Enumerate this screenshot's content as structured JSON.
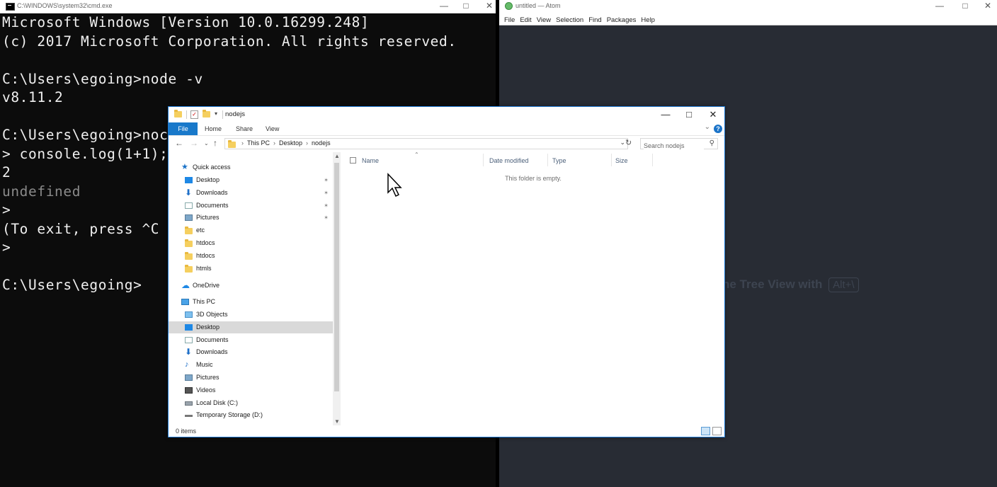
{
  "cmd": {
    "title": "C:\\WINDOWS\\system32\\cmd.exe",
    "lines": [
      {
        "text": "Microsoft Windows [Version 10.0.16299.248]",
        "style": "white"
      },
      {
        "text": "(c) 2017 Microsoft Corporation. All rights reserved.",
        "style": "white"
      },
      {
        "text": "",
        "style": ""
      },
      {
        "text": "C:\\Users\\egoing>node -v",
        "style": "white"
      },
      {
        "text": "v8.11.2",
        "style": "white"
      },
      {
        "text": "",
        "style": ""
      },
      {
        "text": "C:\\Users\\egoing>noc",
        "style": "white"
      },
      {
        "text": "> console.log(1+1);",
        "style": "white"
      },
      {
        "text": "2",
        "style": "white"
      },
      {
        "text": "undefined",
        "style": "dim"
      },
      {
        "text": ">",
        "style": "white"
      },
      {
        "text": "(To exit, press ^C",
        "style": "white"
      },
      {
        "text": ">",
        "style": "white"
      },
      {
        "text": "",
        "style": ""
      },
      {
        "text": "C:\\Users\\egoing>",
        "style": "white"
      }
    ]
  },
  "atom": {
    "title": "untitled — Atom",
    "menu": [
      "File",
      "Edit",
      "View",
      "Selection",
      "Find",
      "Packages",
      "Help"
    ],
    "hint_text": "he Tree View with",
    "hint_key": "Alt+\\"
  },
  "explorer": {
    "title": "nodejs",
    "ribbon_tabs": [
      "File",
      "Home",
      "Share",
      "View"
    ],
    "breadcrumb": [
      "This PC",
      "Desktop",
      "nodejs"
    ],
    "search_placeholder": "Search nodejs",
    "columns": [
      "Name",
      "Date modified",
      "Type",
      "Size"
    ],
    "empty_message": "This folder is empty.",
    "status": "0 items",
    "nav": {
      "quick_access": "Quick access",
      "quick_items": [
        {
          "label": "Desktop",
          "icon": "desktop-icon",
          "pinned": true
        },
        {
          "label": "Downloads",
          "icon": "download-icon",
          "pinned": true
        },
        {
          "label": "Documents",
          "icon": "documents-icon",
          "pinned": true
        },
        {
          "label": "Pictures",
          "icon": "pictures-icon",
          "pinned": true
        },
        {
          "label": "etc",
          "icon": "folder-icon",
          "pinned": false
        },
        {
          "label": "htdocs",
          "icon": "folder-icon",
          "pinned": false
        },
        {
          "label": "htdocs",
          "icon": "folder-icon",
          "pinned": false
        },
        {
          "label": "htmls",
          "icon": "folder-icon",
          "pinned": false
        }
      ],
      "onedrive": "OneDrive",
      "this_pc": "This PC",
      "pc_items": [
        {
          "label": "3D Objects",
          "icon": "3d-objects-icon"
        },
        {
          "label": "Desktop",
          "icon": "desktop-icon",
          "selected": true
        },
        {
          "label": "Documents",
          "icon": "documents-icon"
        },
        {
          "label": "Downloads",
          "icon": "download-icon"
        },
        {
          "label": "Music",
          "icon": "music-icon"
        },
        {
          "label": "Pictures",
          "icon": "pictures-icon"
        },
        {
          "label": "Videos",
          "icon": "videos-icon"
        },
        {
          "label": "Local Disk (C:)",
          "icon": "local-disk-icon"
        },
        {
          "label": "Temporary Storage (D:)",
          "icon": "storage-disk-icon"
        }
      ]
    }
  },
  "colors": {
    "accent": "#1979ca",
    "atom_bg": "#282c34",
    "cmd_bg": "#0c0c0c",
    "selection": "#d9d9d9"
  }
}
